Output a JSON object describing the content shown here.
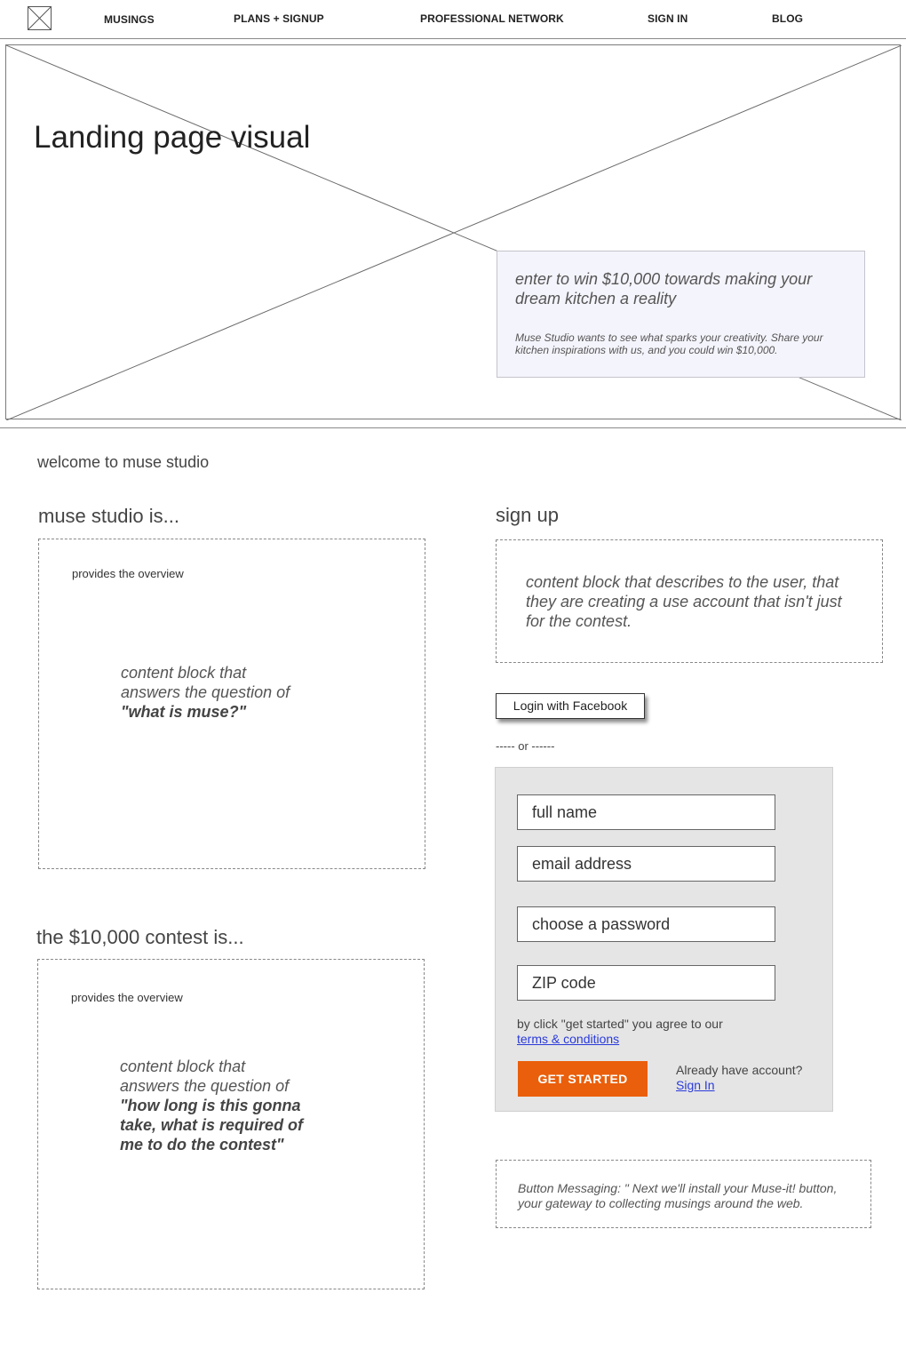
{
  "nav": {
    "logo_icon": "image-placeholder-icon",
    "items": [
      "MUSINGS",
      "PLANS + SIGNUP",
      "PROFESSIONAL NETWORK",
      "SIGN IN",
      "BLOG"
    ]
  },
  "hero": {
    "title": "Landing page visual",
    "promo_heading": "enter to win $10,000 towards making your dream kitchen a reality",
    "promo_text": "Muse Studio wants to see what sparks your creativity. Share your kitchen inspirations with us, and you could win $10,000."
  },
  "welcome": "welcome to muse studio",
  "about": {
    "heading": "muse studio is...",
    "overview": "provides the overview",
    "content_text": "content block that answers the question of",
    "content_question": "\"what is muse?\""
  },
  "contest": {
    "heading": "the $10,000 contest is...",
    "overview": "provides the overview",
    "content_text": "content block that answers the question of",
    "content_question": "\"how long is this gonna take, what is required of me to do the contest\""
  },
  "signup": {
    "heading": "sign up",
    "description": "content block that describes to the user, that they are creating a use account that isn't just for the contest.",
    "facebook_button": "Login with Facebook",
    "or_text": "----- or ------",
    "fields": {
      "full_name": "full name",
      "email": "email address",
      "password": "choose a password",
      "zip": "ZIP code"
    },
    "agree_text": "by click \"get started\" you agree to our",
    "terms_link": "terms & conditions",
    "submit_button": "GET STARTED",
    "already_text": "Already have account?",
    "sign_in_link": "Sign In",
    "button_messaging": "Button Messaging: \" Next we'll install your Muse-it! button, your gateway to collecting musings around the web."
  },
  "colors": {
    "accent": "#ea5f0b",
    "link": "#2a3adb",
    "panel": "#e5e5e5",
    "promo_bg": "#f4f4fc"
  }
}
